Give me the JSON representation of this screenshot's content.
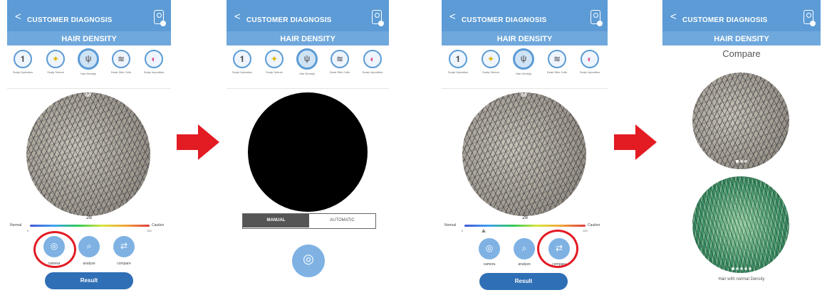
{
  "header": {
    "back_label": "<",
    "title": "CUSTOMER DIAGNOSIS",
    "subtitle": "HAIR DENSITY"
  },
  "categories": [
    {
      "label": "Scalp Hydration",
      "icon": "scalp-hydration-icon",
      "selected": false
    },
    {
      "label": "Scalp Sebum",
      "icon": "scalp-sebum-icon",
      "selected": false
    },
    {
      "label": "Hair Density",
      "icon": "hair-density-icon",
      "selected": true
    },
    {
      "label": "Dead Skin Cells",
      "icon": "dead-skin-cells-icon",
      "selected": false
    },
    {
      "label": "Scalp Impurities",
      "icon": "scalp-impurities-icon",
      "selected": false
    }
  ],
  "screen1": {
    "top_value": "68",
    "bottom_value": "28"
  },
  "screen3": {
    "top_value": "68",
    "bottom_value": "28"
  },
  "scale": {
    "left_label": "Normal",
    "right_label": "Caution",
    "min": "0",
    "max": "100"
  },
  "actions": {
    "camera": "camera",
    "analyze": "analyze",
    "compare": "compare"
  },
  "result_label": "Result",
  "mode": {
    "manual": "MANUAL",
    "automatic": "AUTOMATIC",
    "selected": "MANUAL"
  },
  "compare_screen": {
    "title": "Compare",
    "caption": "Hair with normal Density"
  },
  "colors": {
    "header": "#5c9bd5",
    "accent": "#2f6fb5",
    "highlight_ring": "#e31b23",
    "arrow": "#e31b23"
  }
}
